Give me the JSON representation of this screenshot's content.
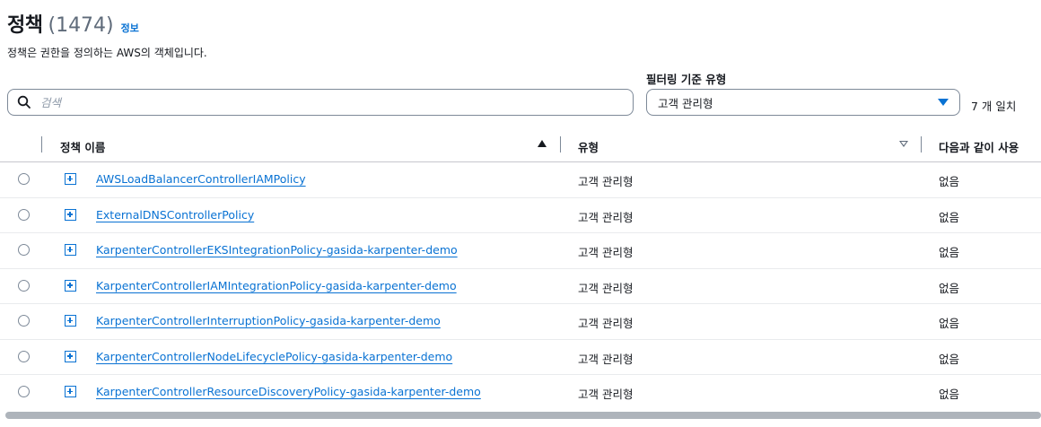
{
  "header": {
    "title": "정책",
    "count": "(1474)",
    "info": "정보",
    "description": "정책은 권한을 정의하는 AWS의 객체입니다."
  },
  "search": {
    "placeholder": "검색",
    "value": ""
  },
  "filter": {
    "label": "필터링 기준 유형",
    "selected": "고객 관리형",
    "match_count": "7 개 일치"
  },
  "table": {
    "columns": [
      "정책 이름",
      "유형",
      "다음과 같이 사용"
    ],
    "rows": [
      {
        "name": "AWSLoadBalancerControllerIAMPolicy",
        "type": "고객 관리형",
        "used_as": "없음"
      },
      {
        "name": "ExternalDNSControllerPolicy",
        "type": "고객 관리형",
        "used_as": "없음"
      },
      {
        "name": "KarpenterControllerEKSIntegrationPolicy-gasida-karpenter-demo",
        "type": "고객 관리형",
        "used_as": "없음"
      },
      {
        "name": "KarpenterControllerIAMIntegrationPolicy-gasida-karpenter-demo",
        "type": "고객 관리형",
        "used_as": "없음"
      },
      {
        "name": "KarpenterControllerInterruptionPolicy-gasida-karpenter-demo",
        "type": "고객 관리형",
        "used_as": "없음"
      },
      {
        "name": "KarpenterControllerNodeLifecyclePolicy-gasida-karpenter-demo",
        "type": "고객 관리형",
        "used_as": "없음"
      },
      {
        "name": "KarpenterControllerResourceDiscoveryPolicy-gasida-karpenter-demo",
        "type": "고객 관리형",
        "used_as": "없음"
      }
    ]
  },
  "icons": {
    "search": "search-icon",
    "dropdown": "caret-down-icon",
    "expand": "expand-plus-icon",
    "sort": "sort-icon"
  },
  "colors": {
    "link": "#0972d3",
    "text": "#16191f",
    "muted": "#5f6b7a"
  }
}
